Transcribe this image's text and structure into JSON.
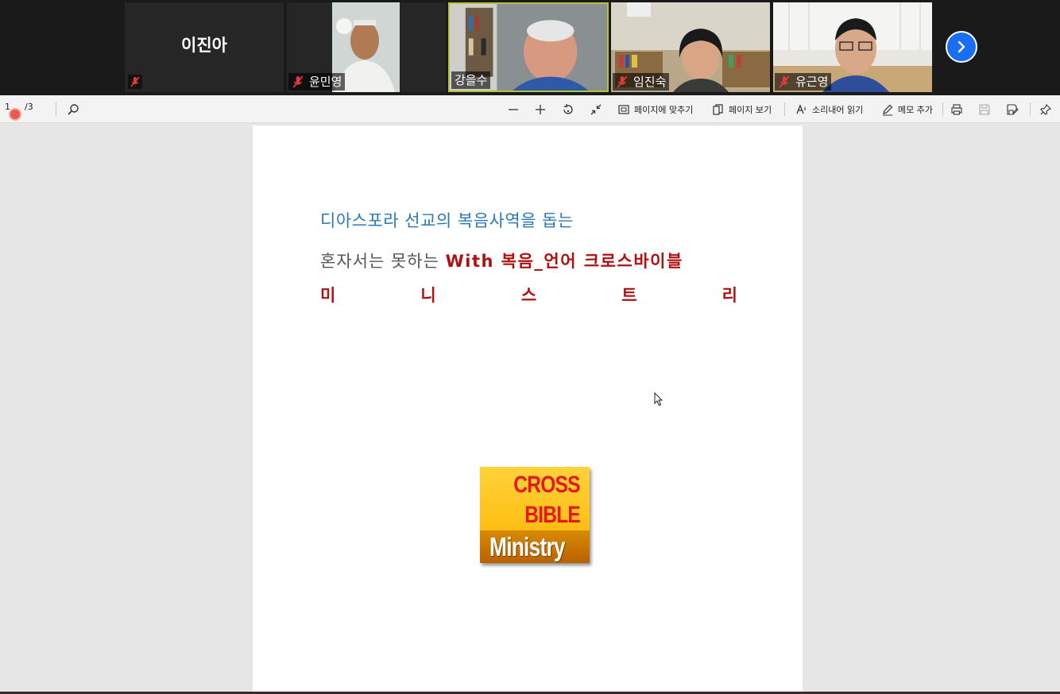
{
  "participants": [
    {
      "name": "이진아",
      "video": false,
      "muted": true
    },
    {
      "name": "윤민영",
      "video": true,
      "muted": true
    },
    {
      "name": "강을수",
      "video": true,
      "muted": false,
      "active_speaker": true
    },
    {
      "name": "임진숙",
      "video": true,
      "muted": true
    },
    {
      "name": "유근영",
      "video": true,
      "muted": true
    }
  ],
  "toolbar": {
    "page_current": "1",
    "page_total": "/3",
    "fit_page_label": "페이지에 맞추기",
    "page_view_label": "페이지 보기",
    "read_aloud_label": "소리내어 읽기",
    "add_note_label": "메모 추가"
  },
  "document": {
    "line1": "디아스포라 선교의 복음사역을 돕는",
    "line2_prefix": "혼자서는 못하는",
    "line2_emphasis": "With 복음_언어 크로스바이블",
    "line3_chars": [
      "미",
      "니",
      "스",
      "트",
      "리"
    ],
    "logo": {
      "line1": "CROSS",
      "line2": "BIBLE",
      "line3": "Ministry"
    }
  },
  "colors": {
    "accent_blue": "#2b78b8",
    "emphasis_red": "#b01010",
    "next_button": "#1a6ef5"
  }
}
